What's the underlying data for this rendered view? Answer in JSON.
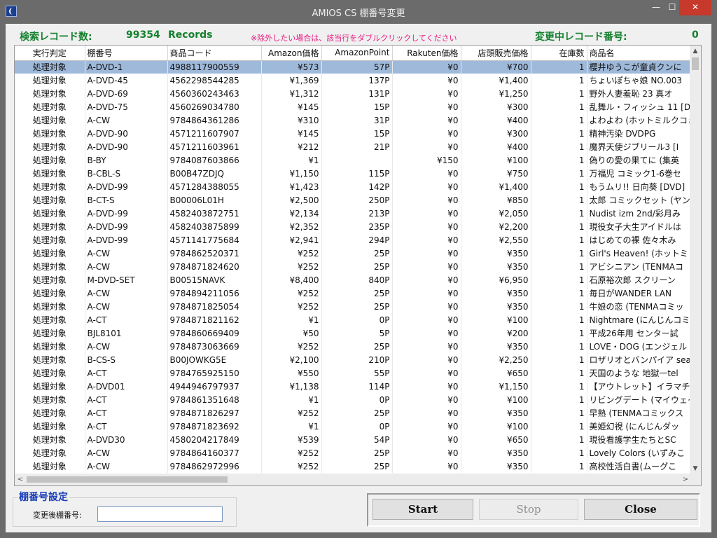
{
  "window": {
    "title": "AMIOS CS 棚番号変更",
    "minimize_glyph": "—",
    "maximize_glyph": "☐",
    "close_glyph": "✕",
    "accent_close": "#c7392b"
  },
  "stats": {
    "search_count_label": "検索レコード数:",
    "search_count_value": "99354",
    "records_label": "Records",
    "notice": "※除外したい場合は、該当行をダブルクリックしてください",
    "changing_label": "変更中レコード番号:",
    "changing_value": "0",
    "colors": {
      "stats_text": "#14802e",
      "notice": "#e8197f"
    }
  },
  "table": {
    "columns": [
      "実行判定",
      "棚番号",
      "商品コード",
      "Amazon価格",
      "AmazonPoint",
      "Rakuten価格",
      "店頭販売価格",
      "在庫数",
      "商品名"
    ],
    "selected_row_index": 0,
    "selection_color": "#9fb9da",
    "rows": [
      [
        "処理対象",
        "A-DVD-1",
        "4988117900559",
        "¥573",
        "57P",
        "¥0",
        "¥700",
        "1",
        "櫻井ゆうこが童貞クンに"
      ],
      [
        "処理対象",
        "A-DVD-45",
        "4562298544285",
        "¥1,369",
        "137P",
        "¥0",
        "¥1,400",
        "1",
        "ちょいぽちゃ娘 NO.003"
      ],
      [
        "処理対象",
        "A-DVD-69",
        "4560360243463",
        "¥1,312",
        "131P",
        "¥0",
        "¥1,250",
        "1",
        "野外人妻羞恥 23 真オ"
      ],
      [
        "処理対象",
        "A-DVD-75",
        "4560269034780",
        "¥145",
        "15P",
        "¥0",
        "¥300",
        "1",
        "乱舞ル・フィッシュ 11 [D"
      ],
      [
        "処理対象",
        "A-CW",
        "9784864361286",
        "¥310",
        "31P",
        "¥0",
        "¥400",
        "1",
        "よわよわ (ホットミルクコミ"
      ],
      [
        "処理対象",
        "A-DVD-90",
        "4571211607907",
        "¥145",
        "15P",
        "¥0",
        "¥300",
        "1",
        "精神汚染 DVDPG"
      ],
      [
        "処理対象",
        "A-DVD-90",
        "4571211603961",
        "¥212",
        "21P",
        "¥0",
        "¥400",
        "1",
        "魔界天使ジブリール3 [I"
      ],
      [
        "処理対象",
        "B-BY",
        "9784087603866",
        "¥1",
        "",
        "¥150",
        "¥100",
        "1",
        "偽りの愛の果てに (集英"
      ],
      [
        "処理対象",
        "B-CBL-S",
        "B00B47ZDJQ",
        "¥1,150",
        "115P",
        "¥0",
        "¥750",
        "1",
        "万福児 コミック1-6巻セ"
      ],
      [
        "処理対象",
        "A-DVD-99",
        "4571284388055",
        "¥1,423",
        "142P",
        "¥0",
        "¥1,400",
        "1",
        "もうムリ!! 日向葵 [DVD]"
      ],
      [
        "処理対象",
        "B-CT-S",
        "B00006L01H",
        "¥2,500",
        "250P",
        "¥0",
        "¥850",
        "1",
        "太郎 コミックセット (ヤン"
      ],
      [
        "処理対象",
        "A-DVD-99",
        "4582403872751",
        "¥2,134",
        "213P",
        "¥0",
        "¥2,050",
        "1",
        "Nudist izm 2nd/彩月み"
      ],
      [
        "処理対象",
        "A-DVD-99",
        "4582403875899",
        "¥2,352",
        "235P",
        "¥0",
        "¥2,200",
        "1",
        "現役女子大生アイドルは"
      ],
      [
        "処理対象",
        "A-DVD-99",
        "4571141775684",
        "¥2,941",
        "294P",
        "¥0",
        "¥2,550",
        "1",
        "はじめての裸 佐々木み"
      ],
      [
        "処理対象",
        "A-CW",
        "9784862520371",
        "¥252",
        "25P",
        "¥0",
        "¥350",
        "1",
        "Girl's Heaven! (ホットミ"
      ],
      [
        "処理対象",
        "A-CW",
        "9784871824620",
        "¥252",
        "25P",
        "¥0",
        "¥350",
        "1",
        "アビシニアン (TENMAコ"
      ],
      [
        "処理対象",
        "M-DVD-SET",
        "B00515NAVK",
        "¥8,400",
        "840P",
        "¥0",
        "¥6,950",
        "1",
        "石原裕次郎 スクリーン"
      ],
      [
        "処理対象",
        "A-CW",
        "9784894211056",
        "¥252",
        "25P",
        "¥0",
        "¥350",
        "1",
        "毎日がWANDER LAN"
      ],
      [
        "処理対象",
        "A-CW",
        "9784871825054",
        "¥252",
        "25P",
        "¥0",
        "¥350",
        "1",
        "牛娘の恋 (TENMAコミッ"
      ],
      [
        "処理対象",
        "A-CT",
        "9784871821162",
        "¥1",
        "0P",
        "¥0",
        "¥100",
        "1",
        "Nightmare (にんじんコミ"
      ],
      [
        "処理対象",
        "BJL8101",
        "9784860669409",
        "¥50",
        "5P",
        "¥0",
        "¥200",
        "1",
        "平成26年用 センター試"
      ],
      [
        "処理対象",
        "A-CW",
        "9784873063669",
        "¥252",
        "25P",
        "¥0",
        "¥350",
        "1",
        "LOVE・DOG (エンジェル"
      ],
      [
        "処理対象",
        "B-CS-S",
        "B00JOWKG5E",
        "¥2,100",
        "210P",
        "¥0",
        "¥2,250",
        "1",
        "ロザリオとバンパイア sea"
      ],
      [
        "処理対象",
        "A-CT",
        "9784765925150",
        "¥550",
        "55P",
        "¥0",
        "¥650",
        "1",
        "天国のような 地獄一tel"
      ],
      [
        "処理対象",
        "A-DVD01",
        "4944946797937",
        "¥1,138",
        "114P",
        "¥0",
        "¥1,150",
        "1",
        "【アウトレット】イラマチオ"
      ],
      [
        "処理対象",
        "A-CT",
        "9784861351648",
        "¥1",
        "0P",
        "¥0",
        "¥100",
        "1",
        "リビングデート (マイウェイ"
      ],
      [
        "処理対象",
        "A-CT",
        "9784871826297",
        "¥252",
        "25P",
        "¥0",
        "¥350",
        "1",
        "早熟 (TENMAコミックス"
      ],
      [
        "処理対象",
        "A-CT",
        "9784871823692",
        "¥1",
        "0P",
        "¥0",
        "¥100",
        "1",
        "美姫幻視 (にんじんダッ"
      ],
      [
        "処理対象",
        "A-DVD30",
        "4580204217849",
        "¥539",
        "54P",
        "¥0",
        "¥650",
        "1",
        "現役看護学生たちとSC"
      ],
      [
        "処理対象",
        "A-CW",
        "9784864160377",
        "¥252",
        "25P",
        "¥0",
        "¥350",
        "1",
        "Lovely Colors (いずみこ"
      ],
      [
        "処理対象",
        "A-CW",
        "9784862972996",
        "¥252",
        "25P",
        "¥0",
        "¥350",
        "1",
        "高校性活白書(ムーグこ"
      ]
    ]
  },
  "scrollbars": {
    "up": "▲",
    "down": "▼",
    "left": "<",
    "right": ">"
  },
  "setting": {
    "group_title": "棚番号設定",
    "field_label": "変更後棚番号:",
    "field_value": ""
  },
  "buttons": {
    "start": "Start",
    "stop": "Stop",
    "close": "Close"
  }
}
